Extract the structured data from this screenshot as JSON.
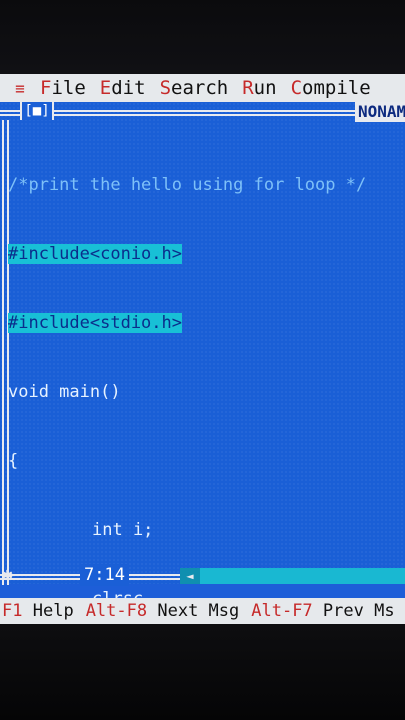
{
  "menu": {
    "system_icon": "≡",
    "items": [
      {
        "hot": "F",
        "rest": "ile"
      },
      {
        "hot": "E",
        "rest": "dit"
      },
      {
        "hot": "S",
        "rest": "earch"
      },
      {
        "hot": "R",
        "rest": "un"
      },
      {
        "hot": "C",
        "rest": "ompile"
      }
    ]
  },
  "window": {
    "close_box": "[■]",
    "filename": "NONAM"
  },
  "code": {
    "comment": "/*print the hello using for loop */",
    "include1": "#include<conio.h>",
    "include2": "#include<stdio.h>",
    "main": "void main()",
    "open_brace": "{",
    "line_int": "int i;",
    "line_clrsc": "clrsc",
    "close_brace": "}"
  },
  "status": {
    "cursor_position": "7:14",
    "hints": [
      {
        "key": "F1",
        "label": "Help"
      },
      {
        "key": "Alt-F8",
        "label": "Next Msg"
      },
      {
        "key": "Alt-F7",
        "label": "Prev Ms"
      }
    ]
  },
  "colors": {
    "editor_bg": "#1a5fd6",
    "menu_bg": "#e6e9ec",
    "hotkey": "#c62a2a",
    "selection": "#18c0d6"
  }
}
